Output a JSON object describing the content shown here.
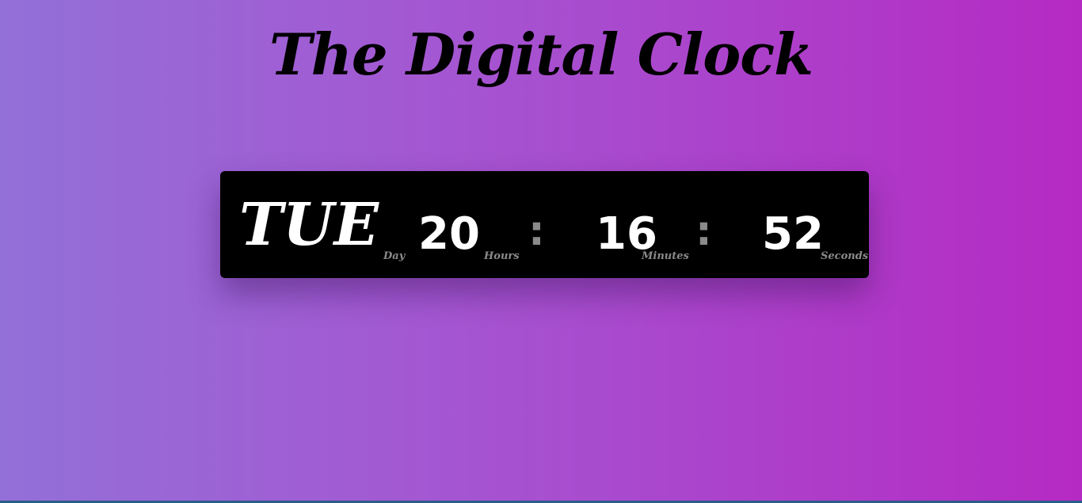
{
  "title": "The Digital Clock",
  "clock": {
    "day": "TUE",
    "hours": "20",
    "minutes": "16",
    "seconds": "52",
    "separator": ":",
    "labels": {
      "day": "Day",
      "hours": "Hours",
      "minutes": "Minutes",
      "seconds": "Seconds"
    }
  },
  "colors": {
    "gradient_start": "#9370d8",
    "gradient_end": "#b52ac3",
    "panel": "#000000",
    "digits": "#ffffff",
    "labels": "#8a8a8a"
  }
}
